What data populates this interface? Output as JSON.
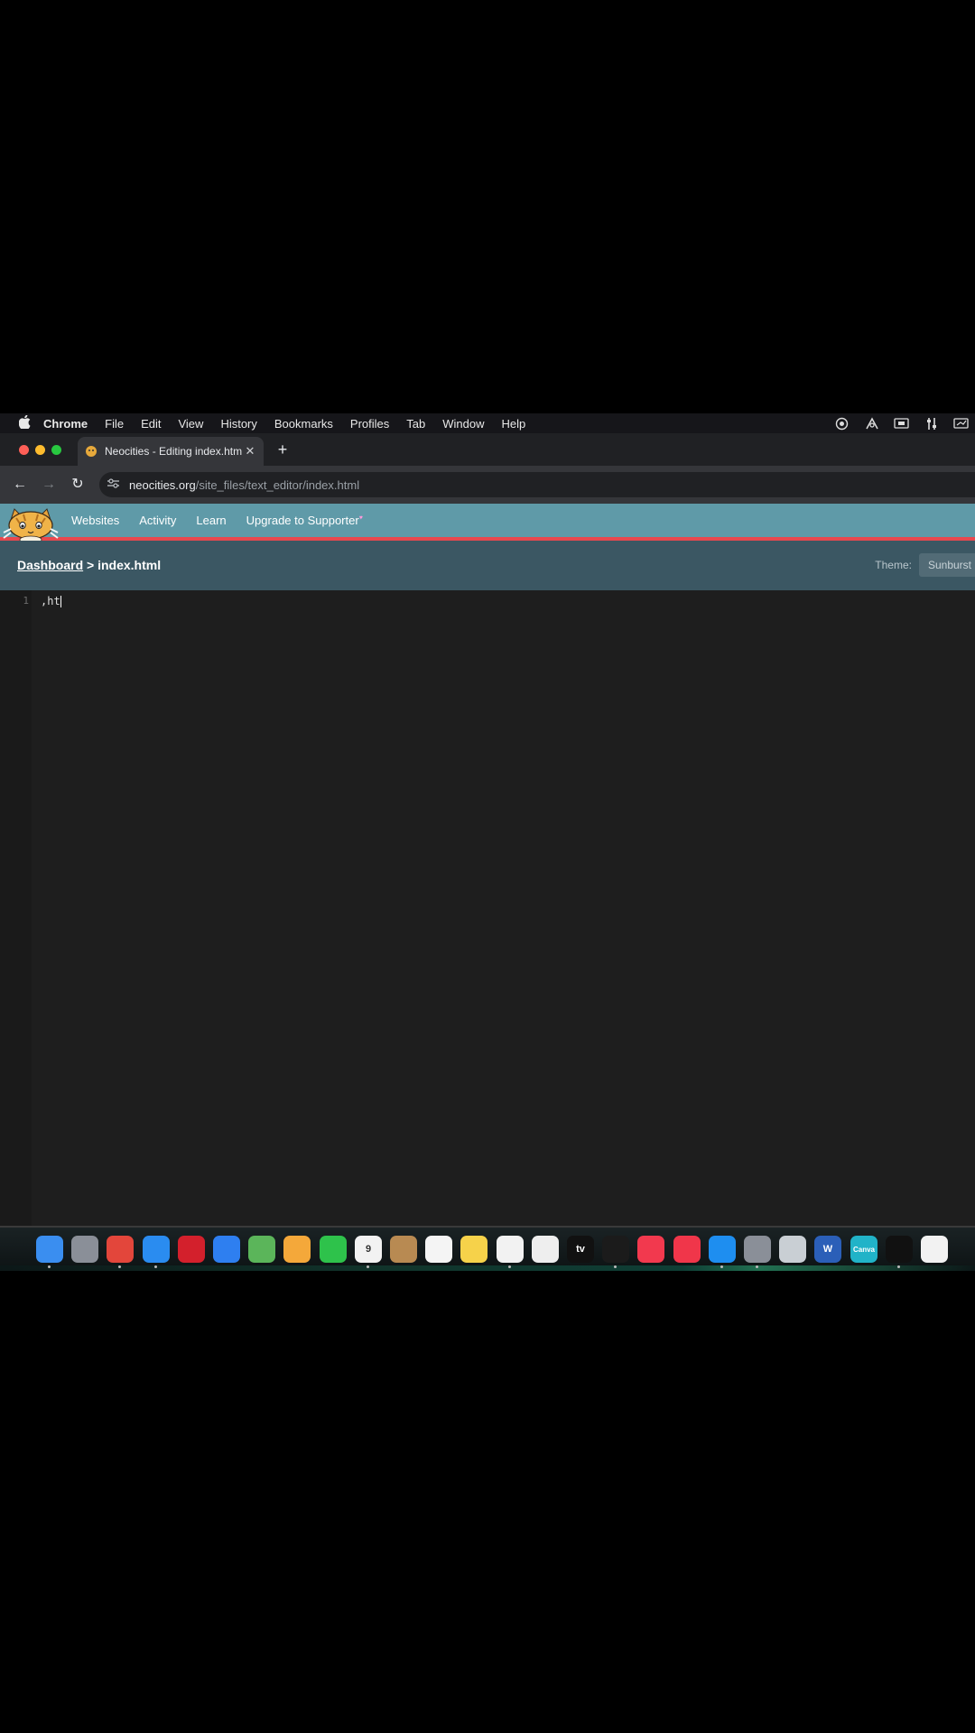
{
  "menubar": {
    "app_name": "Chrome",
    "items": [
      "File",
      "Edit",
      "View",
      "History",
      "Bookmarks",
      "Profiles",
      "Tab",
      "Window",
      "Help"
    ]
  },
  "tab": {
    "title": "Neocities - Editing index.html"
  },
  "address": {
    "host": "neocities.org",
    "path": "/site_files/text_editor/index.html"
  },
  "site_nav": {
    "websites": "Websites",
    "activity": "Activity",
    "learn": "Learn",
    "upgrade": "Upgrade to Supporter",
    "upgrade_mark": "♥"
  },
  "breadcrumb": {
    "dashboard": "Dashboard",
    "separator": ">",
    "file": "index.html"
  },
  "theme": {
    "label": "Theme:",
    "value": "Sunburst"
  },
  "editor": {
    "line_number": "1",
    "line_text": ",ht"
  },
  "dock": {
    "apps": [
      {
        "icon": "finder-icon",
        "color": "#3a8ef0"
      },
      {
        "icon": "launchpad-icon",
        "color": "#8a8f98"
      },
      {
        "icon": "chrome-icon",
        "color": "#e3463b"
      },
      {
        "icon": "safari-icon",
        "color": "#2a8cf0"
      },
      {
        "icon": "opera-icon",
        "color": "#d3202c"
      },
      {
        "icon": "mail-icon",
        "color": "#2e7ff0"
      },
      {
        "icon": "maps-icon",
        "color": "#5bb55a"
      },
      {
        "icon": "photos-icon",
        "color": "#f4a83a"
      },
      {
        "icon": "facetime-icon",
        "color": "#2ec24b"
      },
      {
        "icon": "calendar-icon",
        "color": "#f2f2f2",
        "label": "9"
      },
      {
        "icon": "contacts-icon",
        "color": "#b88a52"
      },
      {
        "icon": "reminders-icon",
        "color": "#f4f4f4"
      },
      {
        "icon": "notes-icon",
        "color": "#f6d24a"
      },
      {
        "icon": "freeform-icon",
        "color": "#f2f2f2"
      },
      {
        "icon": "clock-icon",
        "color": "#eeeeee"
      },
      {
        "icon": "apple-tv-icon",
        "color": "#111111",
        "label": "tv"
      },
      {
        "icon": "terminal-icon",
        "color": "#1b1b1b"
      },
      {
        "icon": "music-icon",
        "color": "#f2394e"
      },
      {
        "icon": "news-icon",
        "color": "#f0364a"
      },
      {
        "icon": "app-store-icon",
        "color": "#1e8ef0"
      },
      {
        "icon": "system-settings-icon",
        "color": "#8a8f98"
      },
      {
        "icon": "roblox-icon",
        "color": "#c9cfd4"
      },
      {
        "icon": "word-icon",
        "color": "#2b5fb8",
        "label": "W"
      },
      {
        "icon": "canva-icon",
        "color": "#21b3c8",
        "label": "Canva"
      },
      {
        "icon": "tidal-icon",
        "color": "#111111"
      },
      {
        "icon": "nordvpn-icon",
        "color": "#f2f2f2"
      }
    ]
  }
}
